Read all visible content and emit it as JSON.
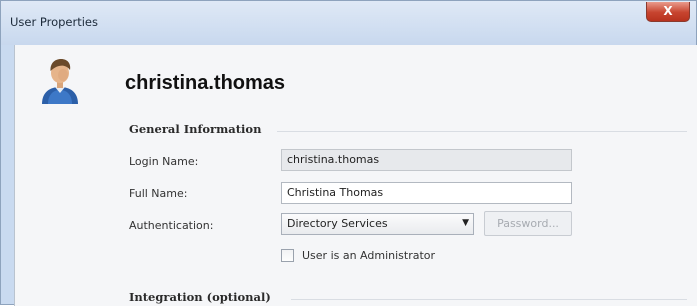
{
  "window": {
    "title": "User Properties",
    "close_label": "X"
  },
  "user": {
    "display_name": "christina.thomas",
    "avatar_icon": "user-avatar-icon"
  },
  "general": {
    "header": "General Information",
    "login_name_label": "Login Name:",
    "login_name_value": "christina.thomas",
    "full_name_label": "Full Name:",
    "full_name_value": "Christina Thomas",
    "authentication_label": "Authentication:",
    "authentication_value": "Directory Services",
    "password_button": "Password...",
    "admin_checkbox_label": "User is an Administrator",
    "admin_checked": false
  },
  "integration": {
    "header": "Integration (optional)"
  },
  "colors": {
    "title_bar": "#c8d8ee",
    "close_button": "#c7442f",
    "client_background": "#f5f6f8"
  }
}
